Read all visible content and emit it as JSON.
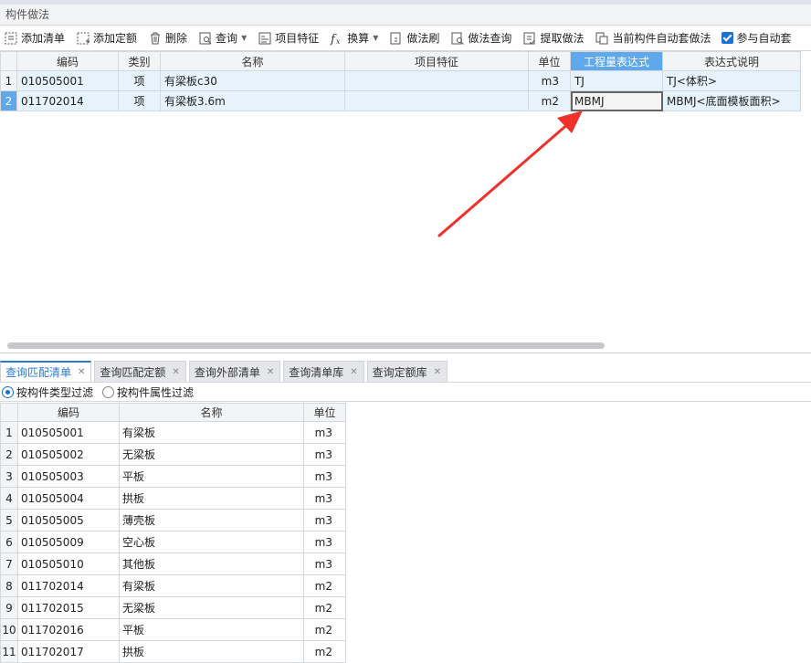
{
  "panel": {
    "title": "构件做法"
  },
  "toolbar": {
    "add_list": "添加清单",
    "add_quota": "添加定额",
    "delete": "删除",
    "query": "查询",
    "item_feature": "项目特征",
    "convert": "换算",
    "method_brush": "做法刷",
    "method_query": "做法查询",
    "extract_method": "提取做法",
    "auto_method": "当前构件自动套做法",
    "participate_auto": "参与自动套"
  },
  "top_grid": {
    "headers": [
      "编码",
      "类别",
      "名称",
      "项目特征",
      "单位",
      "工程量表达式",
      "表达式说明"
    ],
    "rows": [
      {
        "no": "1",
        "code": "010505001",
        "type": "项",
        "name": "有梁板c30",
        "feature": "",
        "unit": "m3",
        "expr": "TJ",
        "desc": "TJ<体积>"
      },
      {
        "no": "2",
        "code": "011702014",
        "type": "项",
        "name": "有梁板3.6m",
        "feature": "",
        "unit": "m2",
        "expr": "MBMJ",
        "desc": "MBMJ<底面模板面积>"
      }
    ]
  },
  "tabs": [
    {
      "label": "查询匹配清单"
    },
    {
      "label": "查询匹配定额"
    },
    {
      "label": "查询外部清单"
    },
    {
      "label": "查询清单库"
    },
    {
      "label": "查询定额库"
    }
  ],
  "filter": {
    "by_type": "按构件类型过滤",
    "by_attr": "按构件属性过滤"
  },
  "bottom_grid": {
    "headers": [
      "编码",
      "名称",
      "单位"
    ],
    "rows": [
      {
        "no": "1",
        "code": "010505001",
        "name": "有梁板",
        "unit": "m3"
      },
      {
        "no": "2",
        "code": "010505002",
        "name": "无梁板",
        "unit": "m3"
      },
      {
        "no": "3",
        "code": "010505003",
        "name": "平板",
        "unit": "m3"
      },
      {
        "no": "4",
        "code": "010505004",
        "name": "拱板",
        "unit": "m3"
      },
      {
        "no": "5",
        "code": "010505005",
        "name": "薄壳板",
        "unit": "m3"
      },
      {
        "no": "6",
        "code": "010505009",
        "name": "空心板",
        "unit": "m3"
      },
      {
        "no": "7",
        "code": "010505010",
        "name": "其他板",
        "unit": "m3"
      },
      {
        "no": "8",
        "code": "011702014",
        "name": "有梁板",
        "unit": "m2"
      },
      {
        "no": "9",
        "code": "011702015",
        "name": "无梁板",
        "unit": "m2"
      },
      {
        "no": "10",
        "code": "011702016",
        "name": "平板",
        "unit": "m2"
      },
      {
        "no": "11",
        "code": "011702017",
        "name": "拱板",
        "unit": "m2"
      }
    ]
  },
  "colors": {
    "accent": "#2a7ad8",
    "header_active": "#5fa8ec",
    "row_highlight": "#e6f2fc",
    "annotation_arrow": "#f0312a"
  }
}
